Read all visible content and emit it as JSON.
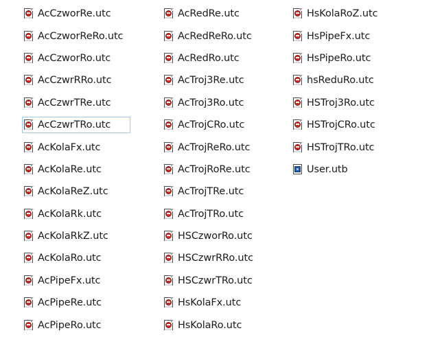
{
  "file_list": {
    "columns": [
      {
        "items": [
          {
            "name": "AcCzworRe.utc",
            "icon": "utc-file-icon"
          },
          {
            "name": "AcCzworReRo.utc",
            "icon": "utc-file-icon"
          },
          {
            "name": "AcCzworRo.utc",
            "icon": "utc-file-icon"
          },
          {
            "name": "AcCzwrRRo.utc",
            "icon": "utc-file-icon"
          },
          {
            "name": "AcCzwrTRe.utc",
            "icon": "utc-file-icon"
          },
          {
            "name": "AcCzwrTRo.utc",
            "icon": "utc-file-icon",
            "focused": true
          },
          {
            "name": "AcKolaFx.utc",
            "icon": "utc-file-icon"
          },
          {
            "name": "AcKolaRe.utc",
            "icon": "utc-file-icon"
          },
          {
            "name": "AcKolaReZ.utc",
            "icon": "utc-file-icon"
          },
          {
            "name": "AcKolaRk.utc",
            "icon": "utc-file-icon"
          },
          {
            "name": "AcKolaRkZ.utc",
            "icon": "utc-file-icon"
          },
          {
            "name": "AcKolaRo.utc",
            "icon": "utc-file-icon"
          },
          {
            "name": "AcPipeFx.utc",
            "icon": "utc-file-icon"
          },
          {
            "name": "AcPipeRe.utc",
            "icon": "utc-file-icon"
          },
          {
            "name": "AcPipeRo.utc",
            "icon": "utc-file-icon"
          }
        ]
      },
      {
        "items": [
          {
            "name": "AcRedRe.utc",
            "icon": "utc-file-icon"
          },
          {
            "name": "AcRedReRo.utc",
            "icon": "utc-file-icon"
          },
          {
            "name": "AcRedRo.utc",
            "icon": "utc-file-icon"
          },
          {
            "name": "AcTroj3Re.utc",
            "icon": "utc-file-icon"
          },
          {
            "name": "AcTroj3Ro.utc",
            "icon": "utc-file-icon"
          },
          {
            "name": "AcTrojCRo.utc",
            "icon": "utc-file-icon"
          },
          {
            "name": "AcTrojReRo.utc",
            "icon": "utc-file-icon"
          },
          {
            "name": "AcTrojRoRe.utc",
            "icon": "utc-file-icon"
          },
          {
            "name": "AcTrojTRe.utc",
            "icon": "utc-file-icon"
          },
          {
            "name": "AcTrojTRo.utc",
            "icon": "utc-file-icon"
          },
          {
            "name": "HSCzworRo.utc",
            "icon": "utc-file-icon"
          },
          {
            "name": "HSCzwrRRo.utc",
            "icon": "utc-file-icon"
          },
          {
            "name": "HSCzwrTRo.utc",
            "icon": "utc-file-icon"
          },
          {
            "name": "HsKolaFx.utc",
            "icon": "utc-file-icon"
          },
          {
            "name": "HsKolaRo.utc",
            "icon": "utc-file-icon"
          }
        ]
      },
      {
        "items": [
          {
            "name": "HsKolaRoZ.utc",
            "icon": "utc-file-icon"
          },
          {
            "name": "HsPipeFx.utc",
            "icon": "utc-file-icon"
          },
          {
            "name": "HsPipeRo.utc",
            "icon": "utc-file-icon"
          },
          {
            "name": "hsReduRo.utc",
            "icon": "utc-file-icon"
          },
          {
            "name": "HSTroj3Ro.utc",
            "icon": "utc-file-icon"
          },
          {
            "name": "HSTrojCRo.utc",
            "icon": "utc-file-icon"
          },
          {
            "name": "HSTrojTRo.utc",
            "icon": "utc-file-icon"
          },
          {
            "name": "User.utb",
            "icon": "utb-file-icon"
          }
        ]
      }
    ]
  },
  "colors": {
    "background": "#ffffff",
    "text": "#1a1a1a",
    "focus_outline": "#a6c8e8",
    "utc_badge": "#c8312b",
    "utb_badge": "#2453a8"
  }
}
